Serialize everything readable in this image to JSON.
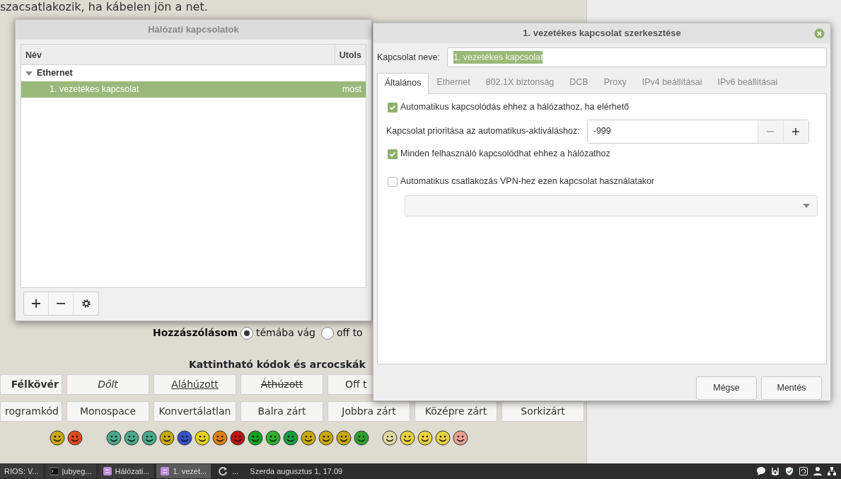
{
  "background_page": {
    "text_line": "szacsatlakozik, ha kábelen jön a net.",
    "reply_type": {
      "label": "Hozzászólásom",
      "options": [
        {
          "label": "témába vág",
          "selected": true
        },
        {
          "label": "off to",
          "selected": false
        }
      ]
    },
    "codes_heading": "Kattintható kódok és arcocskák",
    "format_buttons": [
      [
        {
          "label": "Félkövér",
          "kind": "bold"
        },
        {
          "label": "Dőlt",
          "kind": "italic"
        },
        {
          "label": "Aláhúzott",
          "kind": "underline"
        },
        {
          "label": "Áthúzott",
          "kind": "strike"
        },
        {
          "label": "Off t",
          "kind": "plain"
        }
      ],
      [
        {
          "label": "rogramkód",
          "kind": "plain"
        },
        {
          "label": "Monospace",
          "kind": "plain"
        },
        {
          "label": "Konvertálatlan",
          "kind": "plain"
        },
        {
          "label": "Balra zárt",
          "kind": "plain"
        },
        {
          "label": "Jobbra zárt",
          "kind": "plain"
        },
        {
          "label": "Középre zárt",
          "kind": "plain"
        },
        {
          "label": "Sorkizárt",
          "kind": "plain"
        }
      ]
    ]
  },
  "connections_window": {
    "title": "Hálózati kapcsolatok",
    "columns": [
      "Név",
      "Utols"
    ],
    "tree": [
      {
        "label": "Ethernet",
        "expanded": true,
        "children": [
          {
            "label": "1. vezetékes kapcsolat",
            "last_used": "most",
            "selected": true
          }
        ]
      }
    ]
  },
  "editor": {
    "title": "1. vezetékes kapcsolat szerkesztése",
    "name_label": "Kapcsolat neve:",
    "name_value": "1. vezetékes kapcsolat",
    "tabs": [
      {
        "label": "Általános",
        "selected": true
      },
      {
        "label": "Ethernet",
        "selected": false
      },
      {
        "label": "802.1X biztonság",
        "selected": false
      },
      {
        "label": "DCB",
        "selected": false
      },
      {
        "label": "Proxy",
        "selected": false
      },
      {
        "label": "IPv4 beállításai",
        "selected": false
      },
      {
        "label": "IPv6 beállításai",
        "selected": false
      }
    ],
    "auto_connect": {
      "label": "Automatikus kapcsolódás ehhez a hálózathoz, ha elérhető",
      "checked": true
    },
    "priority": {
      "label": "Kapcsolat prioritása az automatikus-aktiváláshoz:",
      "value": "-999"
    },
    "all_users": {
      "label": "Minden felhasználó kapcsolódhat ehhez a hálózathoz",
      "checked": true
    },
    "vpn": {
      "label": "Automatikus csatlakozás VPN-hez ezen kapcsolat használatakor",
      "checked": false
    },
    "buttons": [
      "Mégse",
      "Mentés"
    ]
  },
  "taskbar": {
    "items": [
      {
        "label": "RIOS: V...",
        "selected": false
      },
      {
        "label": "|ubyeg...",
        "selected": false
      },
      {
        "label": "Hálózati...",
        "selected": false
      },
      {
        "label": "1. vezet...",
        "selected": true
      }
    ],
    "more": "...",
    "clock": "Szerda augusztus  1, 17.09"
  }
}
